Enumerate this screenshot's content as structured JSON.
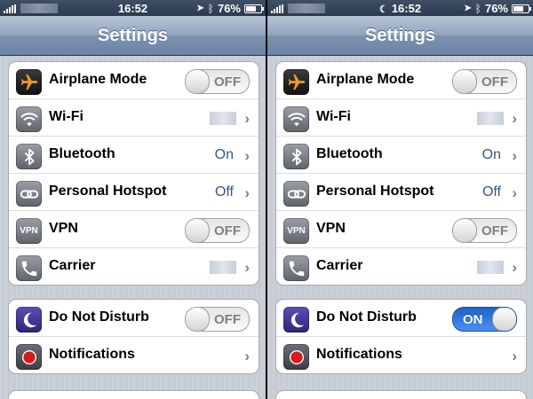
{
  "screens": [
    {
      "status": {
        "time": "16:52",
        "battery": "76%",
        "battery_level": 0.76,
        "dnd_indicator": false
      },
      "navbar": {
        "title": "Settings"
      },
      "group1": {
        "airplane": {
          "label": "Airplane Mode",
          "toggle": "OFF",
          "icon": "airplane-icon"
        },
        "wifi": {
          "label": "Wi-Fi",
          "icon": "wifi-icon"
        },
        "bluetooth": {
          "label": "Bluetooth",
          "value": "On",
          "icon": "bluetooth-icon"
        },
        "hotspot": {
          "label": "Personal Hotspot",
          "value": "Off",
          "icon": "hotspot-icon"
        },
        "vpn": {
          "label": "VPN",
          "toggle": "OFF",
          "icon": "vpn-icon"
        },
        "carrier": {
          "label": "Carrier",
          "icon": "phone-icon"
        }
      },
      "group2": {
        "dnd": {
          "label": "Do Not Disturb",
          "toggle": "OFF",
          "icon": "moon-icon"
        },
        "notifications": {
          "label": "Notifications",
          "icon": "notifications-icon"
        }
      }
    },
    {
      "status": {
        "time": "16:52",
        "battery": "76%",
        "battery_level": 0.76,
        "dnd_indicator": true
      },
      "navbar": {
        "title": "Settings"
      },
      "group1": {
        "airplane": {
          "label": "Airplane Mode",
          "toggle": "OFF",
          "icon": "airplane-icon"
        },
        "wifi": {
          "label": "Wi-Fi",
          "icon": "wifi-icon"
        },
        "bluetooth": {
          "label": "Bluetooth",
          "value": "On",
          "icon": "bluetooth-icon"
        },
        "hotspot": {
          "label": "Personal Hotspot",
          "value": "Off",
          "icon": "hotspot-icon"
        },
        "vpn": {
          "label": "VPN",
          "toggle": "OFF",
          "icon": "vpn-icon"
        },
        "carrier": {
          "label": "Carrier",
          "icon": "phone-icon"
        }
      },
      "group2": {
        "dnd": {
          "label": "Do Not Disturb",
          "toggle": "ON",
          "icon": "moon-icon"
        },
        "notifications": {
          "label": "Notifications",
          "icon": "notifications-icon"
        }
      }
    }
  ],
  "colors": {
    "value_text": "#385487",
    "toggle_on": "#2f75e0",
    "airplane_orange": "#f29a2a",
    "notification_red": "#d71920"
  },
  "vpn_icon_text": "VPN"
}
